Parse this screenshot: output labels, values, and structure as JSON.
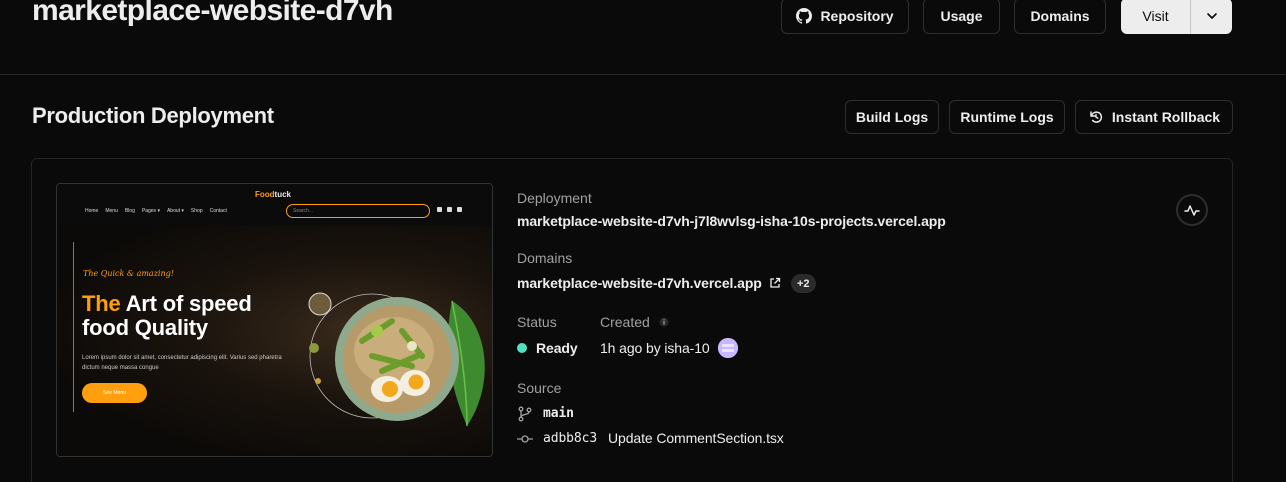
{
  "project": {
    "title": "marketplace-website-d7vh",
    "buttons": {
      "repository": "Repository",
      "usage": "Usage",
      "domains": "Domains",
      "visit": "Visit"
    }
  },
  "section": {
    "title": "Production Deployment",
    "buttons": {
      "build_logs": "Build Logs",
      "runtime_logs": "Runtime Logs",
      "instant_rollback": "Instant Rollback"
    }
  },
  "preview": {
    "logo_part1": "Food",
    "logo_part2": "tuck",
    "nav_links": [
      "Home",
      "Menu",
      "Blog",
      "Pages ▾",
      "About ▾",
      "Shop",
      "Contact"
    ],
    "search_placeholder": "Search...",
    "script_text": "The Quick & amazing!",
    "headline_accent": "The",
    "headline_rest": " Art of speed",
    "headline_line2": "food Quality",
    "lorem": "Lorem ipsum dolor sit amet, consectetur adipiscing elit. Varius sed pharetra dictum neque massa congue",
    "menu_button": "See Menu",
    "accent_color": "#ff9f0d"
  },
  "deployment": {
    "label": "Deployment",
    "url": "marketplace-website-d7vh-j7l8wvlsg-isha-10s-projects.vercel.app"
  },
  "domains": {
    "label": "Domains",
    "url": "marketplace-website-d7vh.vercel.app",
    "extra_count": "+2"
  },
  "status": {
    "label": "Status",
    "value": "Ready",
    "color": "#50e3c2"
  },
  "created": {
    "label": "Created",
    "value": "1h ago by isha-10"
  },
  "source": {
    "label": "Source",
    "branch": "main",
    "commit_hash": "adbb8c3",
    "commit_message": "Update CommentSection.tsx"
  }
}
